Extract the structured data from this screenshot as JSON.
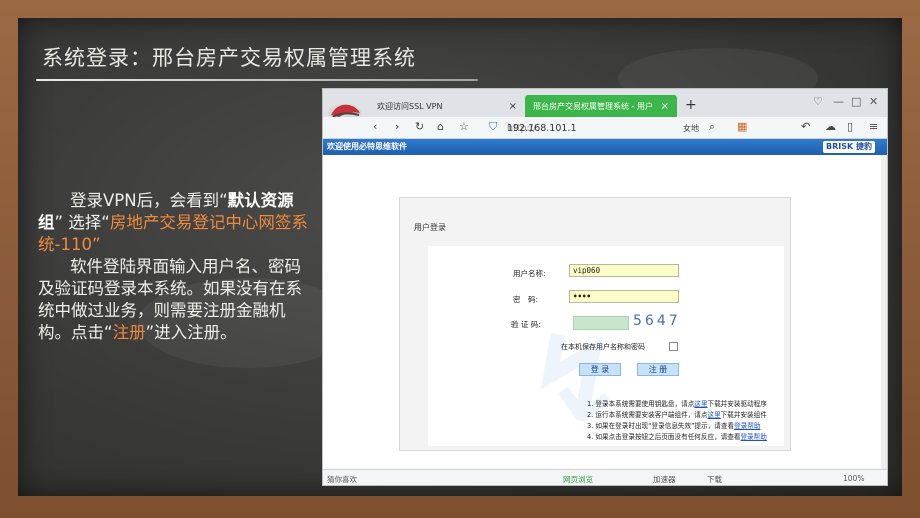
{
  "slide": {
    "title": "系统登录：邢台房产交易权属管理系统",
    "para1_a": "登录VPN后，会看到“",
    "para1_b": "默认资源组",
    "para1_c": "” 选择“",
    "para1_d": "房地产交易登记中心网签系统-110",
    "para1_e": "”",
    "para2_a": "软件登陆界面输入用户名、密码及验证码登录本系统。如果没有在系统中做过业务，则需要注册金融机构。点击“",
    "para2_b": "注册",
    "para2_c": "”进入注册。"
  },
  "browser": {
    "tab1": "欢迎访问SSL VPN",
    "tab1_close": "×",
    "tab2": "邢台房产交易权属管理系统 - 用户",
    "tab2_close": "×",
    "new_tab": "+",
    "url_proto": "http://",
    "url_host": "192.168.101.1",
    "search_hint": "女地",
    "site_banner": "欢迎使用必特思维软件",
    "brand": "BRISK 捷豹",
    "status_left": "猜你喜欢",
    "status_items": [
      "网页浏览",
      "加速器",
      "下载"
    ],
    "zoom": "100%"
  },
  "login": {
    "panel_title": "用户登录",
    "username_label": "用户名称:",
    "username_value": "vip060",
    "password_label": "密　码:",
    "password_value": "••••",
    "captcha_label": "验 证 码:",
    "captcha_code": "5647",
    "remember_label": "在本机保存用户名称和密码",
    "login_button": "登 录",
    "register_button": "注 册",
    "notes": [
      {
        "pre": "1. 登录本系统需要使用钥匙盘，请点",
        "link": "这里",
        "post": "下载并安装驱动程序"
      },
      {
        "pre": "2. 运行本系统需要安装客户端组件，请点",
        "link": "这里",
        "post": "下载并安装组件"
      },
      {
        "pre": "3. 如果在登录时出现“登录信息失效”提示，请查看",
        "link": "登录帮助",
        "post": ""
      },
      {
        "pre": "4. 如果点击登录按钮之后页面没有任何反应，请查看",
        "link": "登录帮助",
        "post": ""
      }
    ]
  }
}
